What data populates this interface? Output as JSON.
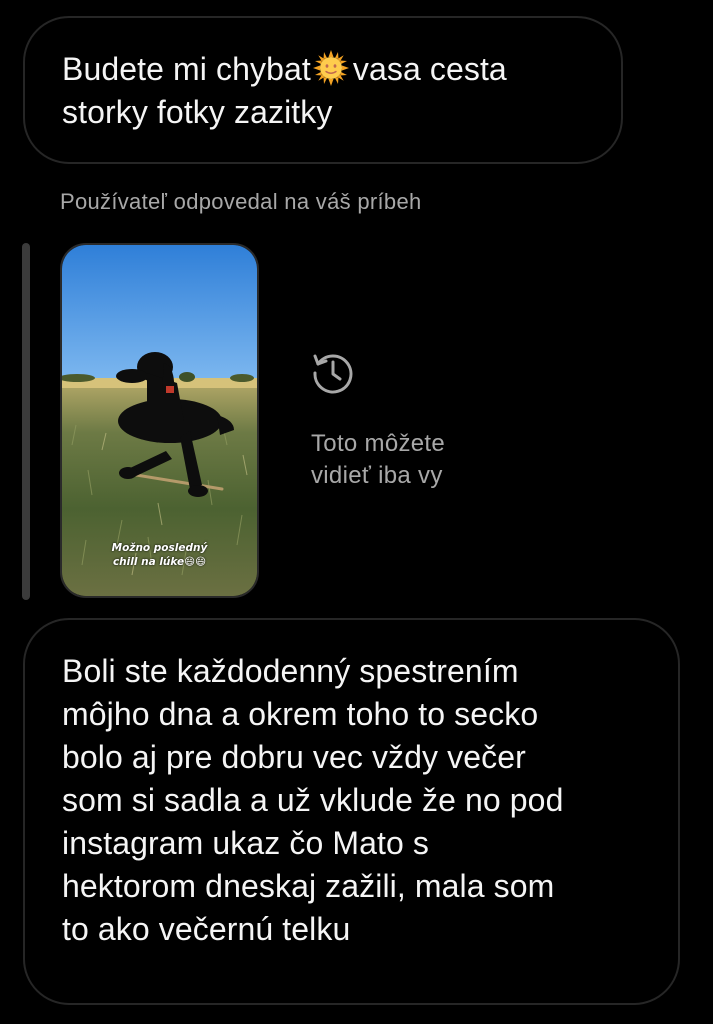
{
  "messages": [
    {
      "direction": "incoming",
      "text_before_emoji": "Budete mi chybat",
      "emoji": "sun-with-face",
      "text_after_emoji": "vasa cesta\nstorky fotky zazitky"
    }
  ],
  "story_reply": {
    "caption": "Používateľ odpovedal na váš príbeh",
    "sticker_text": "Možno posledný\nchill na lúke😄😄",
    "private_note": "Toto môžete\nvidieť iba vy",
    "icon": "history-icon"
  },
  "messages_after": [
    {
      "direction": "incoming",
      "text": "Boli ste každodenný spestrením\nmôjho dna a okrem toho to secko\nbolo aj pre dobru vec vždy večer\nsom si sadla a už vklude že no pod\ninstagram ukaz čo Mato s\nhektorom dneskaj zažili, mala som\nto ako večernú telku"
    }
  ],
  "colors": {
    "background": "#000000",
    "bubble_border": "#262626",
    "secondary_text": "#a8a8a8",
    "quote_bar": "#3b3b3b"
  }
}
